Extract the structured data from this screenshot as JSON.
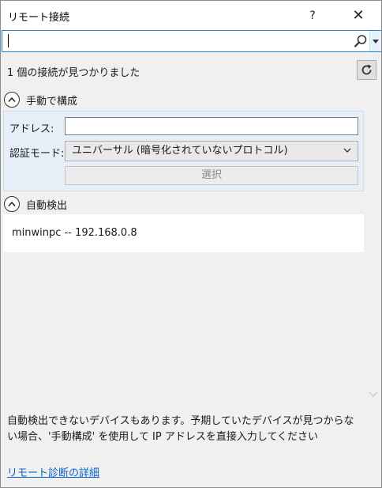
{
  "window": {
    "title": "リモート接続",
    "help_label": "?",
    "close_label": "✕"
  },
  "search": {
    "value": "",
    "placeholder": ""
  },
  "status": {
    "text": "1 個の接続が見つかりました"
  },
  "manual": {
    "header": "手動で構成",
    "address_label": "アドレス:",
    "address_value": "",
    "auth_label": "認証モード:",
    "auth_value": "ユニバーサル (暗号化されていないプロトコル)",
    "select_label": "選択"
  },
  "auto": {
    "header": "自動検出",
    "devices": [
      "minwinpc -- 192.168.0.8"
    ]
  },
  "note": "自動検出できないデバイスもあります。予期していたデバイスが見つからない場合、'手動構成' を使用して IP アドレスを直接入力してください",
  "link": "リモート診断の詳細",
  "colors": {
    "accent": "#1883d7",
    "link": "#0a63c9",
    "panel": "#e6eef7"
  },
  "icons": [
    "search-icon",
    "dropdown-arrow-icon",
    "refresh-icon",
    "collapse-chevron-icon",
    "chevron-down-icon"
  ]
}
